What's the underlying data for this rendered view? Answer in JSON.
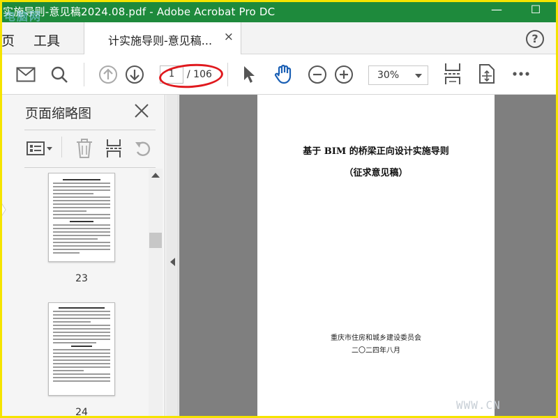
{
  "window": {
    "title": "实施导则-意见稿2024.08.pdf - Adobe Acrobat Pro DC",
    "watermark": "电脑网",
    "minimize_glyph": "—",
    "maximize_glyph": "☐"
  },
  "tabs": {
    "home_partial": "页",
    "tools": "工具",
    "document_tab": "计实施导则-意见稿...",
    "close_glyph": "×",
    "help_glyph": "?"
  },
  "toolbar": {
    "current_page": "1",
    "total_pages": "/ 106",
    "zoom": "30%",
    "icons": [
      "mail-icon",
      "search-icon",
      "prev-page-icon",
      "next-page-icon",
      "select-pointer-icon",
      "hand-tool-icon",
      "zoom-out-icon",
      "zoom-in-icon",
      "fit-page-icon",
      "rotate-view-icon",
      "more-icon"
    ],
    "annotation_color": "#e0191e"
  },
  "sidebar": {
    "title": "页面缩略图",
    "thumbnails": [
      {
        "page_label": "23"
      },
      {
        "page_label": "24"
      }
    ]
  },
  "document": {
    "title_line1": "基于 BIM 的桥梁正向设计实施导则",
    "title_line2": "（征求意见稿）",
    "issuer": "重庆市住房和城乡建设委员会",
    "date": "二〇二四年八月"
  },
  "footer_watermark": "WWW.CN",
  "colors": {
    "titlebar": "#1e8a3c",
    "accent_blue": "#1a5fb4",
    "doc_background": "#7f7f7f",
    "frame": "#f5e400"
  }
}
